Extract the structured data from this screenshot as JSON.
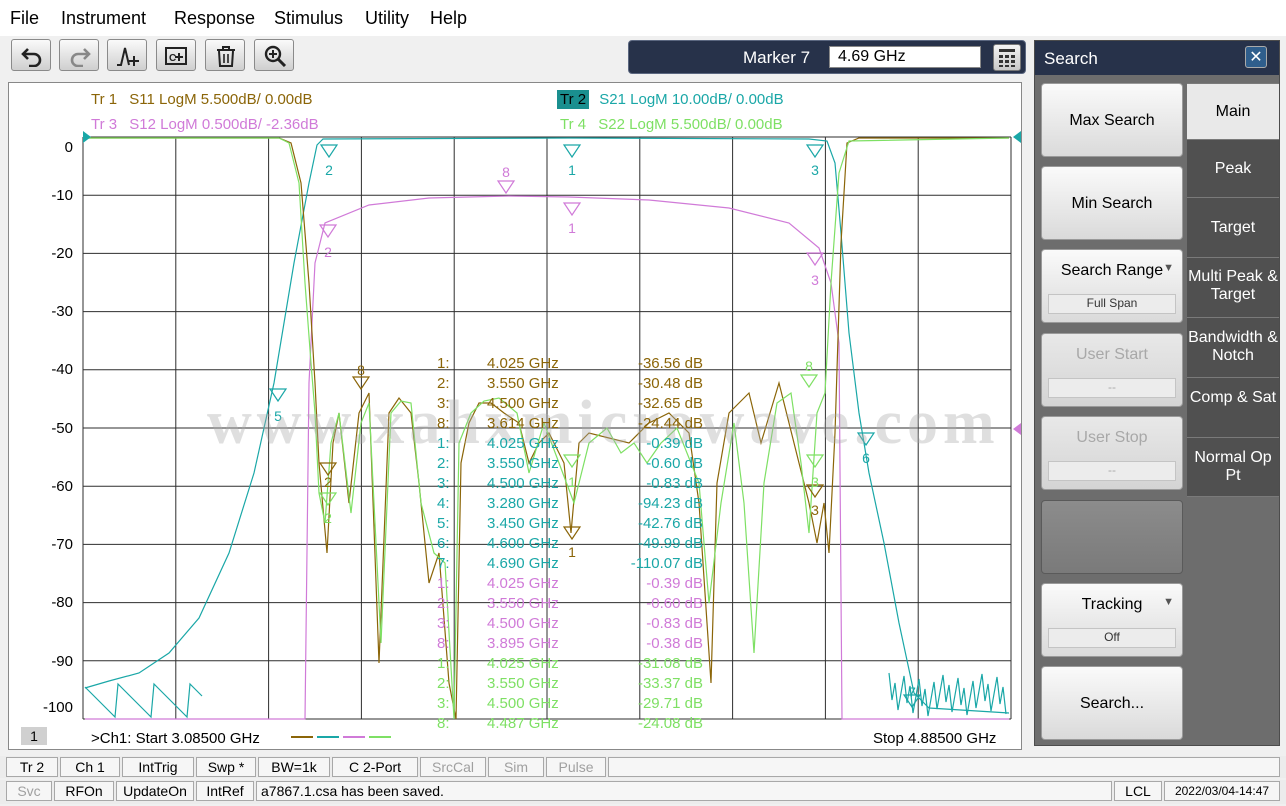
{
  "menu": [
    "File",
    "Instrument",
    "Response",
    "Stimulus",
    "Utility",
    "Help"
  ],
  "toolbar": {
    "icons": [
      "undo-icon",
      "redo-icon",
      "marker-add-icon",
      "screen-capture-icon",
      "delete-icon",
      "zoom-icon"
    ]
  },
  "marker": {
    "label": "Marker 7",
    "value": "4.69 GHz"
  },
  "traces": {
    "tr1": {
      "id": "Tr 1",
      "desc": "S11 LogM 5.500dB/  0.00dB",
      "color": "#8b6508"
    },
    "tr2": {
      "id": "Tr 2",
      "desc": "S21 LogM 10.00dB/  0.00dB",
      "color": "#1aa7a7"
    },
    "tr3": {
      "id": "Tr 3",
      "desc": "S12 LogM 0.500dB/  -2.36dB",
      "color": "#d07ad8"
    },
    "tr4": {
      "id": "Tr 4",
      "desc": "S22 LogM 5.500dB/  0.00dB",
      "color": "#7ee064"
    }
  },
  "yaxis": {
    "labels": [
      "0",
      "-10",
      "-20",
      "-30",
      "-40",
      "-50",
      "-60",
      "-70",
      "-80",
      "-90",
      "-100"
    ]
  },
  "watermark": "www.xahxmicrowave.com",
  "channel_badge": "1",
  "start_label": ">Ch1:  Start  3.08500 GHz",
  "stop_label": "Stop  4.88500 GHz",
  "marker_table": [
    {
      "num": "1:",
      "freq": "4.025  GHz",
      "val": "-36.56 dB",
      "color": "#8b6508"
    },
    {
      "num": "2:",
      "freq": "3.550  GHz",
      "val": "-30.48 dB",
      "color": "#8b6508"
    },
    {
      "num": "3:",
      "freq": "4.500  GHz",
      "val": "-32.65 dB",
      "color": "#8b6508"
    },
    {
      "num": "8:",
      "freq": "3.614  GHz",
      "val": "-24.44 dB",
      "color": "#8b6508"
    },
    {
      "num": "1:",
      "freq": "4.025  GHz",
      "val": "-0.39 dB",
      "color": "#1aa7a7"
    },
    {
      "num": "2:",
      "freq": "3.550  GHz",
      "val": "-0.60 dB",
      "color": "#1aa7a7"
    },
    {
      "num": "3:",
      "freq": "4.500  GHz",
      "val": "-0.83 dB",
      "color": "#1aa7a7"
    },
    {
      "num": "4:",
      "freq": "3.280  GHz",
      "val": "-94.23 dB",
      "color": "#1aa7a7"
    },
    {
      "num": "5:",
      "freq": "3.450  GHz",
      "val": "-42.76 dB",
      "color": "#1aa7a7"
    },
    {
      "num": "6:",
      "freq": "4.600  GHz",
      "val": "-49.99 dB",
      "color": "#1aa7a7"
    },
    {
      "num": "7:",
      "freq": "4.690  GHz",
      "val": "-110.07 dB",
      "color": "#1aa7a7"
    },
    {
      "num": "1:",
      "freq": "4.025  GHz",
      "val": "-0.39 dB",
      "color": "#d07ad8"
    },
    {
      "num": "2:",
      "freq": "3.550  GHz",
      "val": "-0.60 dB",
      "color": "#d07ad8"
    },
    {
      "num": "3:",
      "freq": "4.500  GHz",
      "val": "-0.83 dB",
      "color": "#d07ad8"
    },
    {
      "num": "8:",
      "freq": "3.895  GHz",
      "val": "-0.38 dB",
      "color": "#d07ad8"
    },
    {
      "num": "1:",
      "freq": "4.025  GHz",
      "val": "-31.08 dB",
      "color": "#7ee064"
    },
    {
      "num": "2:",
      "freq": "3.550  GHz",
      "val": "-33.37 dB",
      "color": "#7ee064"
    },
    {
      "num": "3:",
      "freq": "4.500  GHz",
      "val": "-29.71 dB",
      "color": "#7ee064"
    },
    {
      "num": "8:",
      "freq": "4.487  GHz",
      "val": "-24.08 dB",
      "color": "#7ee064"
    }
  ],
  "search_panel": {
    "title": "Search",
    "close": "✕",
    "max_search": "Max Search",
    "min_search": "Min Search",
    "search_range": "Search Range",
    "search_range_value": "Full Span",
    "user_start": "User Start",
    "user_start_value": "--",
    "user_stop": "User Stop",
    "user_stop_value": "--",
    "tracking": "Tracking",
    "tracking_value": "Off",
    "search_more": "Search...",
    "tabs": [
      "Main",
      "Peak",
      "Target",
      "Multi Peak & Target",
      "Bandwidth & Notch",
      "Comp & Sat",
      "Normal Op Pt"
    ]
  },
  "statusbar1": [
    "Tr 2",
    "Ch 1",
    "IntTrig",
    "Swp *",
    "BW=1k",
    "C  2-Port",
    "SrcCal",
    "Sim",
    "Pulse"
  ],
  "statusbar2": [
    "Svc",
    "RFOn",
    "UpdateOn",
    "IntRef",
    "a7867.1.csa has been saved.",
    "LCL",
    "2022/03/04-14:47"
  ]
}
